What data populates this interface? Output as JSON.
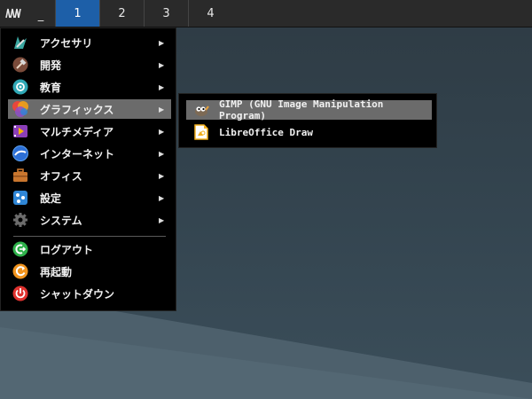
{
  "panel": {
    "launcher_icon": "grid-menu-icon",
    "minimize_label": "_",
    "workspaces": [
      "1",
      "2",
      "3",
      "4"
    ],
    "active_workspace": "1",
    "active_color": "#1d5fa8"
  },
  "main_menu": {
    "items": [
      {
        "label": "アクセサリ",
        "icon": "accessories-icon",
        "submenu": true
      },
      {
        "label": "開発",
        "icon": "development-hammer-icon",
        "submenu": true
      },
      {
        "label": "教育",
        "icon": "education-icon",
        "submenu": true
      },
      {
        "label": "グラフィックス",
        "icon": "graphics-icon",
        "submenu": true,
        "highlighted": true
      },
      {
        "label": "マルチメディア",
        "icon": "multimedia-icon",
        "submenu": true
      },
      {
        "label": "インターネット",
        "icon": "internet-icon",
        "submenu": true
      },
      {
        "label": "オフィス",
        "icon": "office-briefcase-icon",
        "submenu": true
      },
      {
        "label": "設定",
        "icon": "settings-icon",
        "submenu": true
      },
      {
        "label": "システム",
        "icon": "system-gear-icon",
        "submenu": true
      }
    ],
    "session_items": [
      {
        "label": "ログアウト",
        "icon": "logout-icon"
      },
      {
        "label": "再起動",
        "icon": "reboot-icon"
      },
      {
        "label": "シャットダウン",
        "icon": "shutdown-icon"
      }
    ],
    "submenu_arrow": "▶"
  },
  "graphics_submenu": {
    "items": [
      {
        "label": "GIMP (GNU Image Manipulation Program)",
        "icon": "gimp-icon",
        "highlighted": true
      },
      {
        "label": "LibreOffice Draw",
        "icon": "libreoffice-draw-icon"
      }
    ]
  }
}
